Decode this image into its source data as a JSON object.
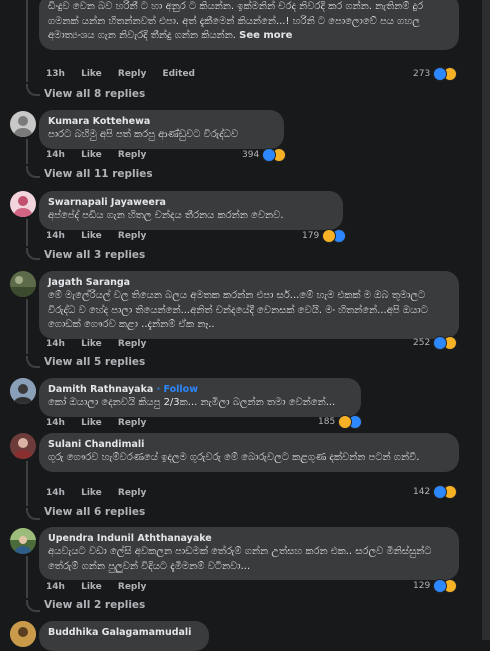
{
  "c0": {
    "text": "ඩිංදුව වෙන බව හරිනී ට හා අනුර ට කියන්න. ඉක්මනින් චරද නිවරදි කර ගන්න. නැතිනම් දුර ගමනක් යන්න හිතන්නවත් එපා. අත් දැකීමෙන් කියන්නේ...! හරිනි ට පොලොවේ පය ගහල අමාත්‍යංශය ගැන නිවැරදි තීන්දු ගන්න කියන්න.",
    "see_more": "See more",
    "time": "13h",
    "like": "Like",
    "reply": "Reply",
    "edited": "Edited",
    "count": "273",
    "view_all": "View all 8 replies"
  },
  "c1": {
    "name": "Kumara Kottehewa",
    "text": "පාරට බහිමු අපි පත් කරපු ආණ්ඩුවට විරුද්ධව",
    "time": "14h",
    "like": "Like",
    "reply": "Reply",
    "count": "394",
    "view_all": "View all 11 replies"
  },
  "c2": {
    "name": "Swarnapali Jayaweera",
    "text": "අප්පේද් පඩිය ගැන හිතල චන්දය තීරනය කරන්න වෙනව.",
    "time": "14h",
    "like": "Like",
    "reply": "Reply",
    "count": "179",
    "view_all": "View all 3 replies"
  },
  "c3": {
    "name": "Jagath Saranga",
    "text": "මේ මැලේරියල් වල තියෙන බලය අමතක කරන්න එපා සර්...මේ හැම එකක් ම ඔබ තුමාලට විරුද්ධ ව හේද පාලා තියෙන්නේ...අනිත් චන්දයේදී වෙනසක් වෙයි. මං හිතන්නේ...අපි ඔයාට ගොඩක් ගෞරව කළා ..දැන්නම් ඒක නෑ..",
    "time": "14h",
    "like": "Like",
    "reply": "Reply",
    "count": "252",
    "view_all": "View all 5 replies"
  },
  "c4": {
    "name": "Damith Rathnayaka",
    "follow": "· Follow",
    "text": "කෝ ඔයාලා දෙනවයි කියපු 2/3ක... නැමිලා බලන්න තමා වෙන්නේ...",
    "time": "14h",
    "like": "Like",
    "reply": "Reply",
    "count": "185"
  },
  "c5": {
    "name": "Sulani Chandimali",
    "text": "ගුරු ගෞරව හැම්වරණයේ ඉදලම ගුරුවරු මේ බොරුවලට කළගුණ දක්වන්න පටන් ගන්වී.",
    "time": "14h",
    "like": "Like",
    "reply": "Reply",
    "count": "142",
    "view_all": "View all 6 replies"
  },
  "c6": {
    "name": "Upendra Indunil Aththanayake",
    "text": "අයවැයට වඩා ලේසි අවකලන පාඩමක් තේරුම් ගන්න උත්සහ කරන එක.. සරලව මිනිස්සුන්ට තේරුම් ගන්න පුලුවන් විදියට දැමීමනම් වටිනවා...",
    "time": "14h",
    "like": "Like",
    "reply": "Reply",
    "count": "129",
    "view_all": "View all 2 replies"
  },
  "c7": {
    "name": "Buddhika Galagamamudali"
  },
  "colors": {
    "background": "#18191a",
    "bubble": "#3a3b3c",
    "like": "#2d88ff",
    "haha": "#f7b125",
    "secondary_text": "#b0b3b8"
  }
}
